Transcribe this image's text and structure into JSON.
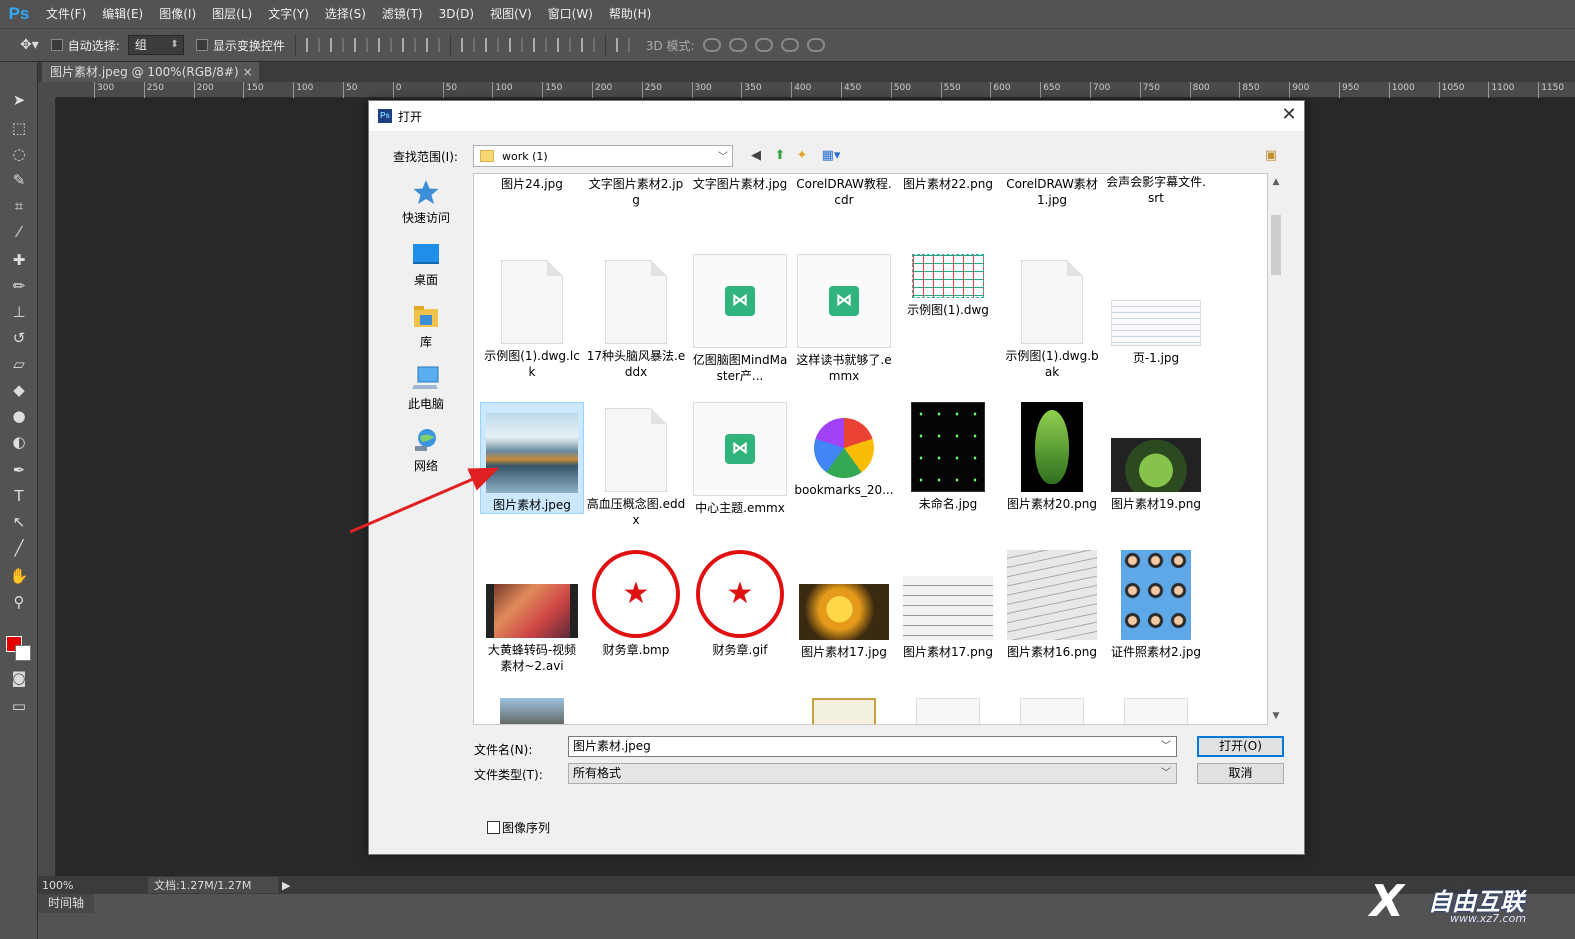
{
  "app": {
    "logo": "Ps",
    "menu": [
      "文件(F)",
      "编辑(E)",
      "图像(I)",
      "图层(L)",
      "文字(Y)",
      "选择(S)",
      "滤镜(T)",
      "3D(D)",
      "视图(V)",
      "窗口(W)",
      "帮助(H)"
    ]
  },
  "options": {
    "auto_select_label": "自动选择:",
    "auto_select_value": "组",
    "show_transform_label": "显示变换控件",
    "mode3d_label": "3D 模式:"
  },
  "document": {
    "tab_title": "图片素材.jpeg @ 100%(RGB/8#)",
    "tab_close": "×"
  },
  "ruler": {
    "top_ticks": [
      "300",
      "250",
      "200",
      "150",
      "100",
      "50",
      "0",
      "50",
      "100",
      "150",
      "200",
      "250",
      "300",
      "350",
      "400",
      "450",
      "500",
      "550",
      "600",
      "650",
      "700",
      "750",
      "800",
      "850",
      "900",
      "950",
      "1000",
      "1050",
      "1100",
      "1150"
    ]
  },
  "statusbar": {
    "zoom": "100%",
    "doc_info": "文档:1.27M/1.27M",
    "timeline_tab": "时间轴"
  },
  "dialog": {
    "title": "打开",
    "close": "✕",
    "lookin_label": "查找范围(I):",
    "lookin_value": "work (1)",
    "places": [
      {
        "label": "快速访问",
        "icon": "star-icon"
      },
      {
        "label": "桌面",
        "icon": "desktop-icon"
      },
      {
        "label": "库",
        "icon": "library-icon"
      },
      {
        "label": "此电脑",
        "icon": "computer-icon"
      },
      {
        "label": "网络",
        "icon": "network-icon"
      }
    ],
    "files": [
      {
        "name": "图片24.jpg",
        "kind": "landscape-partial"
      },
      {
        "name": "文字图片素材2.jpg",
        "kind": "image-partial"
      },
      {
        "name": "文字图片素材.jpg",
        "kind": "image-partial"
      },
      {
        "name": "CorelDRAW教程.cdr",
        "kind": "image-partial"
      },
      {
        "name": "图片素材22.png",
        "kind": "stamp-partial"
      },
      {
        "name": "CorelDRAW素材1.jpg",
        "kind": "image-partial"
      },
      {
        "name": "会声会影字幕文件.srt",
        "kind": "doc-partial"
      },
      {
        "name": "示例图(1).dwg.lck",
        "kind": "doc"
      },
      {
        "name": "17种头脑风暴法.eddx",
        "kind": "doc"
      },
      {
        "name": "亿图脑图MindMaster产...",
        "kind": "mindmaster"
      },
      {
        "name": "这样读书就够了.emmx",
        "kind": "mindmaster"
      },
      {
        "name": "示例图(1).dwg",
        "kind": "dwg"
      },
      {
        "name": "示例图(1).dwg.bak",
        "kind": "doc"
      },
      {
        "name": "页-1.jpg",
        "kind": "diagram"
      },
      {
        "name": "图片素材.jpeg",
        "kind": "lake",
        "selected": true
      },
      {
        "name": "高血压概念图.eddx",
        "kind": "doc"
      },
      {
        "name": "中心主题.emmx",
        "kind": "mindmaster"
      },
      {
        "name": "bookmarks_20...",
        "kind": "pinwheel"
      },
      {
        "name": "未命名.jpg",
        "kind": "black"
      },
      {
        "name": "图片素材20.png",
        "kind": "leaf"
      },
      {
        "name": "图片素材19.png",
        "kind": "plant"
      },
      {
        "name": "大黄蜂转码-视频素材~2.avi",
        "kind": "video"
      },
      {
        "name": "财务章.bmp",
        "kind": "stamp"
      },
      {
        "name": "财务章.gif",
        "kind": "stamp"
      },
      {
        "name": "图片素材17.jpg",
        "kind": "autumn"
      },
      {
        "name": "图片素材17.png",
        "kind": "handwriting"
      },
      {
        "name": "图片素材16.png",
        "kind": "paper"
      },
      {
        "name": "证件照素材2.jpg",
        "kind": "idphotos"
      }
    ],
    "filename_label": "文件名(N):",
    "filename_value": "图片素材.jpeg",
    "filetype_label": "文件类型(T):",
    "filetype_value": "所有格式",
    "open_button": "打开(O)",
    "cancel_button": "取消",
    "image_sequence_label": "图像序列"
  },
  "watermark": {
    "text": "自由互联",
    "sub": "www.xz7.com",
    "mark": "X"
  },
  "colors": {
    "annotation_arrow": "#e02020",
    "selection_bg": "#cce8ff",
    "ps_panel": "#535353",
    "foreground_swatch": "#e60000",
    "background_swatch": "#ffffff"
  }
}
